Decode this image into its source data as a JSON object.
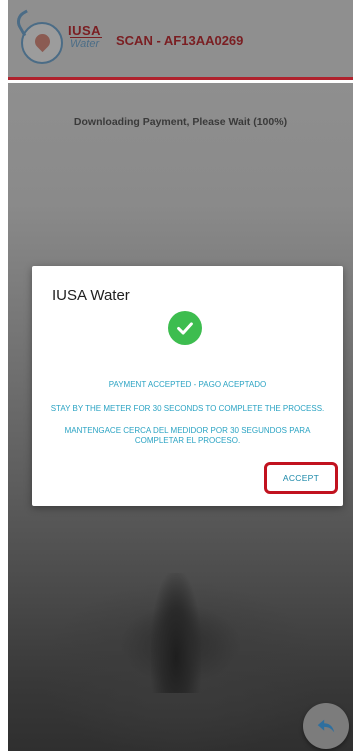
{
  "header": {
    "brand_top": "IUSA",
    "brand_bottom": "Water",
    "title": "SCAN - AF13AA0269"
  },
  "status": {
    "text": "Downloading Payment, Please Wait (100%)"
  },
  "dialog": {
    "title": "IUSA Water",
    "icon": "check-circle-icon",
    "message_1": "PAYMENT ACCEPTED - PAGO ACEPTADO",
    "message_2": "STAY BY THE METER FOR 30 SECONDS TO COMPLETE THE PROCESS.",
    "message_3": "MANTENGACE CERCA DEL MEDIDOR POR 30 SEGUNDOS PARA COMPLETAR EL PROCESO.",
    "accept_label": "ACCEPT"
  },
  "fab": {
    "icon": "reply-arrow-icon"
  },
  "colors": {
    "accent_red": "#b0222d",
    "success_green": "#3dbd4f",
    "message_blue": "#2aa3c3",
    "button_text": "#1a88a8"
  }
}
